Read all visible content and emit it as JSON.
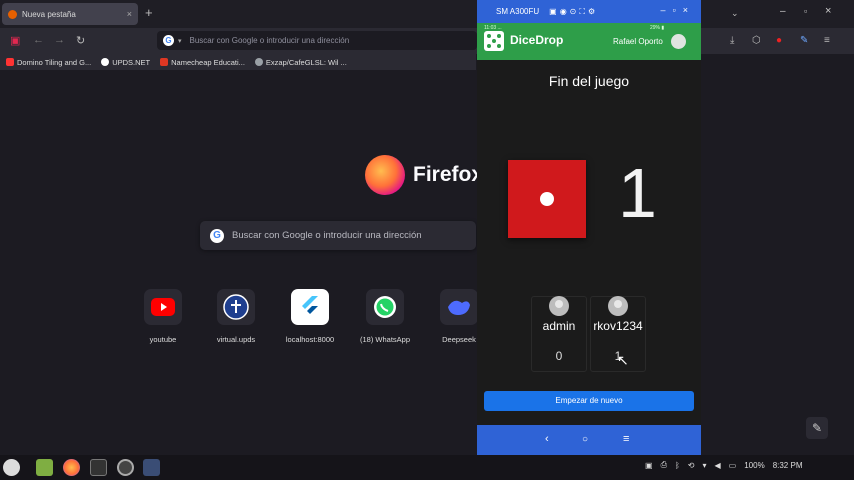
{
  "browser": {
    "tab_title": "Nueva pestaña",
    "tab_close": "×",
    "new_tab": "+",
    "address_placeholder": "Buscar con Google o introducir una dirección",
    "bookmarks": [
      {
        "label": "Domino Tiling and G...",
        "color": "#ff3333"
      },
      {
        "label": "UPDS.NET",
        "color": "#ffffff"
      },
      {
        "label": "Namecheap Educati...",
        "color": "#de3723"
      },
      {
        "label": "Exzap/CafeGLSL: Wil ...",
        "color": "#9aa0a6"
      }
    ]
  },
  "newtab": {
    "brand": "Firefox",
    "search_placeholder": "Buscar con Google o introducir una dirección",
    "shortcuts": [
      {
        "label": "youtube",
        "icon": "youtube-icon"
      },
      {
        "label": "virtual.upds",
        "icon": "upds-icon"
      },
      {
        "label": "localhost:8000",
        "icon": "flutter-icon"
      },
      {
        "label": "(18) WhatsApp",
        "icon": "whatsapp-icon"
      },
      {
        "label": "Deepseek",
        "icon": "deepseek-icon"
      }
    ]
  },
  "phone_window": {
    "device_name": "SM A300FU"
  },
  "app": {
    "name": "DiceDrop",
    "status_left": "11:03 ...",
    "status_right": "29% ▮",
    "user": "Rafael Oporto",
    "title": "Fin del juego",
    "die_value": 1,
    "roll_display": "1",
    "players": [
      {
        "name": "admin",
        "score": "0"
      },
      {
        "name": "rkov1234",
        "score": "1"
      }
    ],
    "restart_label": "Empezar de nuevo",
    "die_color": "#d0191c",
    "accent": "#2e9e49"
  },
  "taskbar": {
    "battery": "100%",
    "time": "8:32 PM"
  }
}
